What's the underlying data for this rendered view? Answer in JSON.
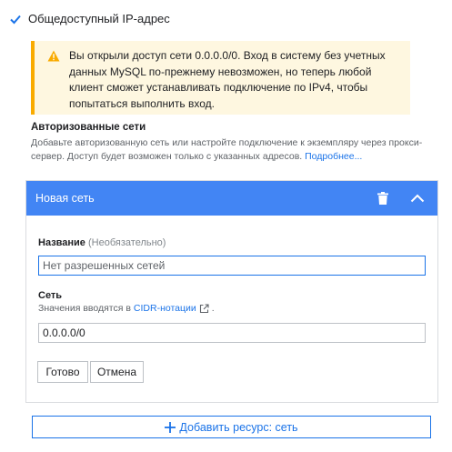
{
  "public_ip": {
    "label": "Общедоступный IP-адрес",
    "checked": true
  },
  "warning": {
    "text": "Вы открыли доступ сети 0.0.0.0/0. Вход в систему без учетных данных MySQL по-прежнему невозможен, но теперь любой клиент сможет устанавливать подключение по IPv4, чтобы попытаться выполнить вход."
  },
  "authorized_networks": {
    "title": "Авторизованные сети",
    "description": "Добавьте авторизованную сеть или настройте подключение к экземпляру через прокси-сервер. Доступ будет возможен только с указанных адресов.",
    "learn_more": "Подробнее..."
  },
  "new_network": {
    "header_title": "Новая сеть",
    "name_label": "Название",
    "name_optional": "(Необязательно)",
    "name_placeholder": "Нет разрешенных сетей",
    "name_value": "",
    "network_label": "Сеть",
    "network_hint_prefix": "Значения вводятся в",
    "network_hint_link": "CIDR-нотации",
    "network_hint_suffix": ".",
    "network_value": "0.0.0.0/0",
    "done_label": "Готово",
    "cancel_label": "Отмена"
  },
  "add_network": {
    "label": "Добавить ресурс: сеть"
  },
  "colors": {
    "accent": "#1a73e8",
    "header": "#4285f4",
    "warning_bg": "#fef7e0",
    "warning_bar": "#f9ab00"
  }
}
